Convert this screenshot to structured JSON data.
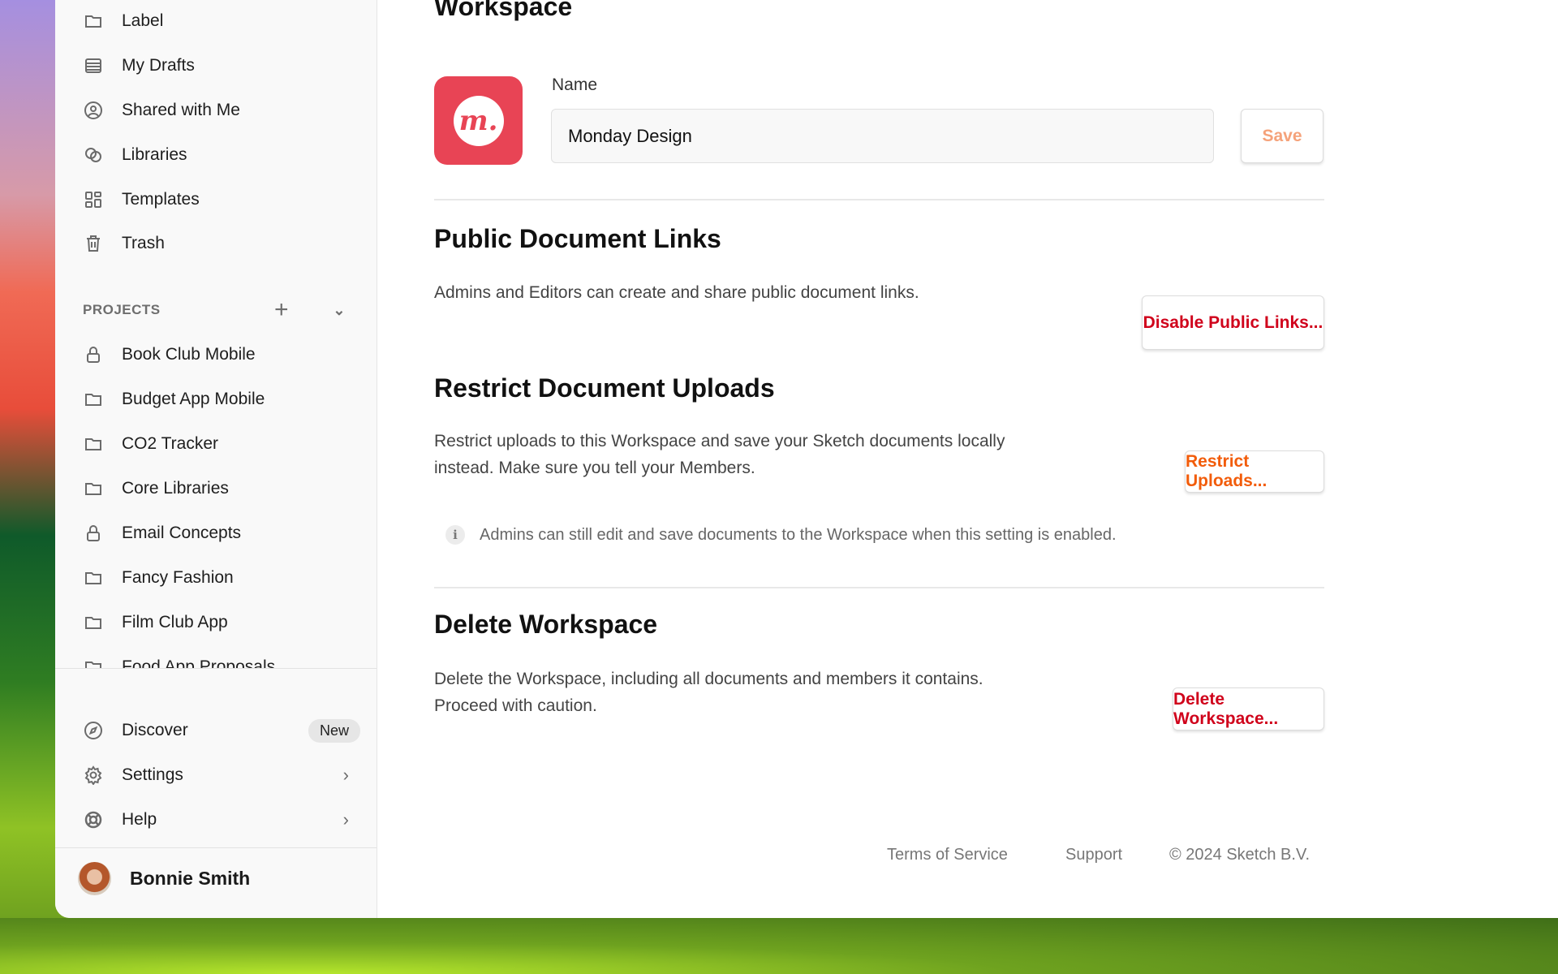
{
  "sidebar": {
    "items": [
      {
        "label": "Label",
        "icon": "folder-icon"
      },
      {
        "label": "My Drafts",
        "icon": "drafts-icon"
      },
      {
        "label": "Shared with Me",
        "icon": "user-circle-icon"
      },
      {
        "label": "Libraries",
        "icon": "libraries-icon"
      },
      {
        "label": "Templates",
        "icon": "templates-icon"
      },
      {
        "label": "Trash",
        "icon": "trash-icon"
      }
    ],
    "projects_header": "PROJECTS",
    "projects": [
      {
        "label": "Book Club Mobile",
        "icon": "lock-icon"
      },
      {
        "label": "Budget App Mobile",
        "icon": "folder-icon"
      },
      {
        "label": "CO2 Tracker",
        "icon": "folder-icon"
      },
      {
        "label": "Core Libraries",
        "icon": "folder-icon"
      },
      {
        "label": "Email Concepts",
        "icon": "lock-icon"
      },
      {
        "label": "Fancy Fashion",
        "icon": "folder-icon"
      },
      {
        "label": "Film Club App",
        "icon": "folder-icon"
      },
      {
        "label": "Food App Proposals",
        "icon": "folder-icon"
      }
    ],
    "bottom": [
      {
        "label": "Discover",
        "icon": "compass-icon",
        "badge": "New"
      },
      {
        "label": "Settings",
        "icon": "gear-icon"
      },
      {
        "label": "Help",
        "icon": "lifebuoy-icon"
      }
    ],
    "user": "Bonnie Smith"
  },
  "main": {
    "title": "Workspace",
    "logo_letter": "m.",
    "name_label": "Name",
    "name_value": "Monday Design",
    "save": "Save",
    "public_links": {
      "title": "Public Document Links",
      "desc": "Admins and Editors can create and share public document links.",
      "button": "Disable Public Links..."
    },
    "restrict": {
      "title": "Restrict Document Uploads",
      "desc": "Restrict uploads to this Workspace and save your Sketch documents locally instead. Make sure you tell your Members.",
      "button": "Restrict Uploads...",
      "note": "Admins can still edit and save documents to the Workspace when this setting is enabled."
    },
    "delete": {
      "title": "Delete Workspace",
      "desc": "Delete the Workspace, including all documents and members it contains. Proceed with caution.",
      "button": "Delete Workspace..."
    }
  },
  "footer": {
    "terms": "Terms of Service",
    "support": "Support",
    "copyright": "© 2024 Sketch B.V."
  },
  "colors": {
    "danger": "#d0021b",
    "warning": "#f25c0a",
    "save_disabled": "#f5a27a",
    "logo": "#e84455"
  }
}
